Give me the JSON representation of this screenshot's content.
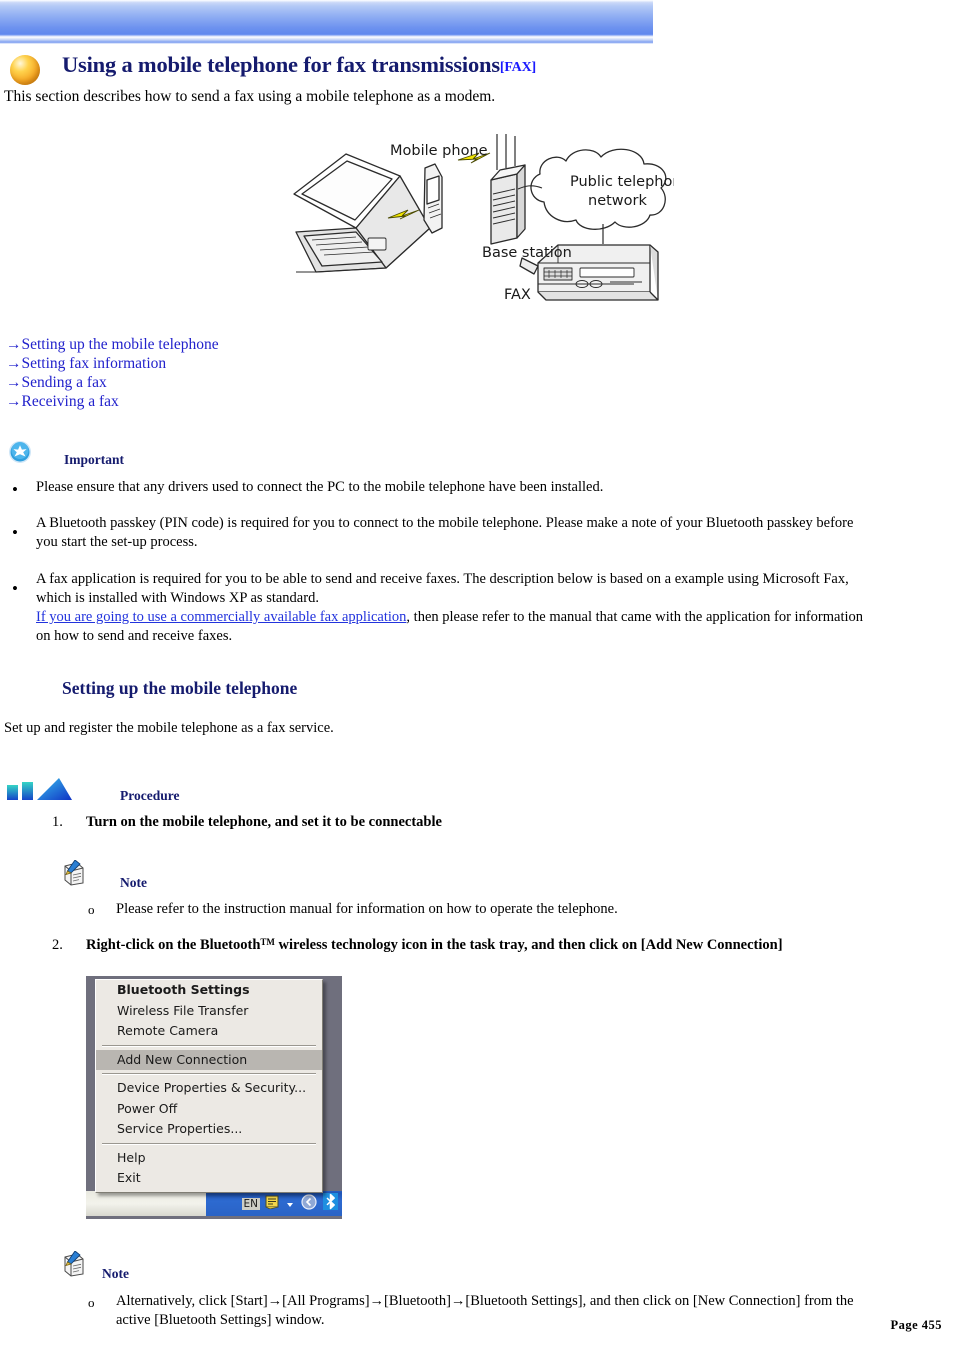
{
  "header": {
    "banner_color_top": "#c9d8f8",
    "banner_color_mid": "#6e93ef",
    "title": "Using a mobile telephone for fax transmissions",
    "title_tag": "[FAX]",
    "title_color": "#151b6e",
    "tag_color": "#1a1aff",
    "intro": "This section describes how to send a fax using a mobile telephone as a modem.",
    "ball_icon": "orange-sphere-icon"
  },
  "figure": {
    "alt": "diagram of PC connecting via mobile phone to base station, public telephone network and FAX machine",
    "labels": {
      "mobile_phone": "Mobile phone",
      "base_station": "Base station",
      "public_network_line1": "Public telephone",
      "public_network_line2": "network",
      "fax": "FAX"
    }
  },
  "nav_links": [
    {
      "arrow": "→",
      "label": "Setting up the mobile telephone"
    },
    {
      "arrow": "→",
      "label": "Setting fax information"
    },
    {
      "arrow": "→",
      "label": "Sending a fax"
    },
    {
      "arrow": "→",
      "label": "Receiving a fax"
    }
  ],
  "important": {
    "icon": "blue-star-badge-icon",
    "heading": "Important",
    "bullets": [
      {
        "marker": "•",
        "lines": [
          "Please ensure that any drivers used to connect the PC to the mobile telephone have been installed."
        ]
      },
      {
        "marker": "•",
        "lines": [
          "A Bluetooth passkey (PIN code) is required for you to connect to the mobile telephone. Please make a note of your Bluetooth passkey before",
          "you start the set-up process."
        ]
      },
      {
        "marker": "•",
        "lines": [
          "A fax application is required for you to be able to send and receive faxes. The description below is based on a example using Microsoft Fax,",
          "which is installed with Windows XP as standard."
        ],
        "link_text": "If you are going to use a commercially available fax application",
        "link_tail": ", then please refer to the manual that came with the application for information",
        "last_line": "on how to send and receive faxes."
      }
    ]
  },
  "section": {
    "heading": "Setting up the mobile telephone",
    "intro": "Set up and register the mobile telephone as a fax service."
  },
  "procedure": {
    "icon": "blue-triangle-procedure-icon",
    "heading": "Procedure",
    "steps": [
      {
        "number": "1.",
        "text": "Turn on the mobile telephone, and set it to be connectable"
      },
      {
        "number": "2.",
        "text_before_sup": "Right-click on the Bluetooth",
        "sup": "TM",
        "text_after_sup": " wireless technology icon in the task tray, and then click on [Add New Connection]"
      }
    ]
  },
  "note_1": {
    "icon": "note-paper-pencil-icon",
    "heading": "Note",
    "marker": "o",
    "text": "Please refer to the instruction manual for information on how to operate the telephone."
  },
  "note_2": {
    "icon": "note-paper-pencil-icon",
    "heading": "Note",
    "marker": "o",
    "line1": "Alternatively, click [Start]→[All Programs]→[Bluetooth]→[Bluetooth Settings], and then click on [New Connection] from the",
    "line2": "active [Bluetooth Settings] window."
  },
  "screenshot": {
    "name": "bluetooth-tray-context-menu",
    "menu_items": [
      {
        "label": "Bluetooth Settings",
        "bold": true,
        "selected": false,
        "sep_after": false
      },
      {
        "label": "Wireless File Transfer",
        "bold": false,
        "selected": false,
        "sep_after": false
      },
      {
        "label": "Remote Camera",
        "bold": false,
        "selected": false,
        "sep_after": true
      },
      {
        "label": "Add New Connection",
        "bold": false,
        "selected": true,
        "sep_after": true
      },
      {
        "label": "Device Properties & Security...",
        "bold": false,
        "selected": false,
        "sep_after": false
      },
      {
        "label": "Power Off",
        "bold": false,
        "selected": false,
        "sep_after": false
      },
      {
        "label": "Service Properties...",
        "bold": false,
        "selected": false,
        "sep_after": true
      },
      {
        "label": "Help",
        "bold": false,
        "selected": false,
        "sep_after": false
      },
      {
        "label": "Exit",
        "bold": false,
        "selected": false,
        "sep_after": false
      }
    ],
    "tray": {
      "language": "EN",
      "icons": [
        "notepad-icon",
        "chevron-down-icon",
        "show-hidden-icon",
        "bluetooth-icon"
      ],
      "bluetooth_color": "#1e8fe0",
      "highlight_color": "#b9b6b1"
    }
  },
  "footer": {
    "page_label": "Page 455"
  }
}
